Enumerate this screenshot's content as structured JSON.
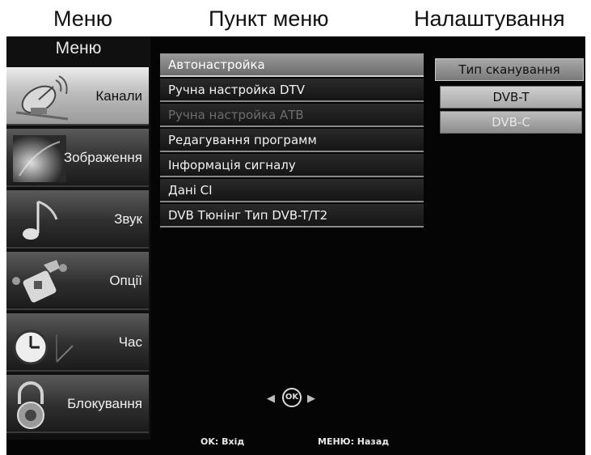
{
  "headings": {
    "menu": "Меню",
    "menu_item": "Пункт меню",
    "settings": "Налаштування"
  },
  "sidebar": {
    "title": "Меню",
    "items": [
      {
        "label": "Канали",
        "icon": "satellite-dish-icon"
      },
      {
        "label": "Зображення",
        "icon": "picture-icon"
      },
      {
        "label": "Звук",
        "icon": "music-note-icon"
      },
      {
        "label": "Опції",
        "icon": "wrench-icon"
      },
      {
        "label": "Час",
        "icon": "clock-icon"
      },
      {
        "label": "Блокування",
        "icon": "padlock-icon"
      }
    ],
    "active_index": 0
  },
  "menu": {
    "items": [
      {
        "label": "Автонастройка",
        "state": "selected"
      },
      {
        "label": "Ручна настройка DTV",
        "state": "normal"
      },
      {
        "label": "Ручна настройка АТВ",
        "state": "disabled"
      },
      {
        "label": "Редагування программ",
        "state": "normal"
      },
      {
        "label": "Інформація сигналу",
        "state": "normal"
      },
      {
        "label": "Дані CI",
        "state": "normal"
      },
      {
        "label": "DVB Тюнінг Тип  DVB-T/T2",
        "state": "normal"
      }
    ]
  },
  "settings": {
    "header": "Тип сканування",
    "options": [
      "DVB-T",
      "DVB-C"
    ],
    "highlighted": "DVB-T"
  },
  "navigation": {
    "ok_label": "OK",
    "left_arrow": "◀",
    "right_arrow": "▶"
  },
  "footer": {
    "ok_hint": "OK: Вхід",
    "back_hint": "МЕНЮ: Назад"
  },
  "colors": {
    "screen_bg": "#050505",
    "selected_item": "#8a8a8a",
    "disabled_text": "#6d6d6d"
  }
}
